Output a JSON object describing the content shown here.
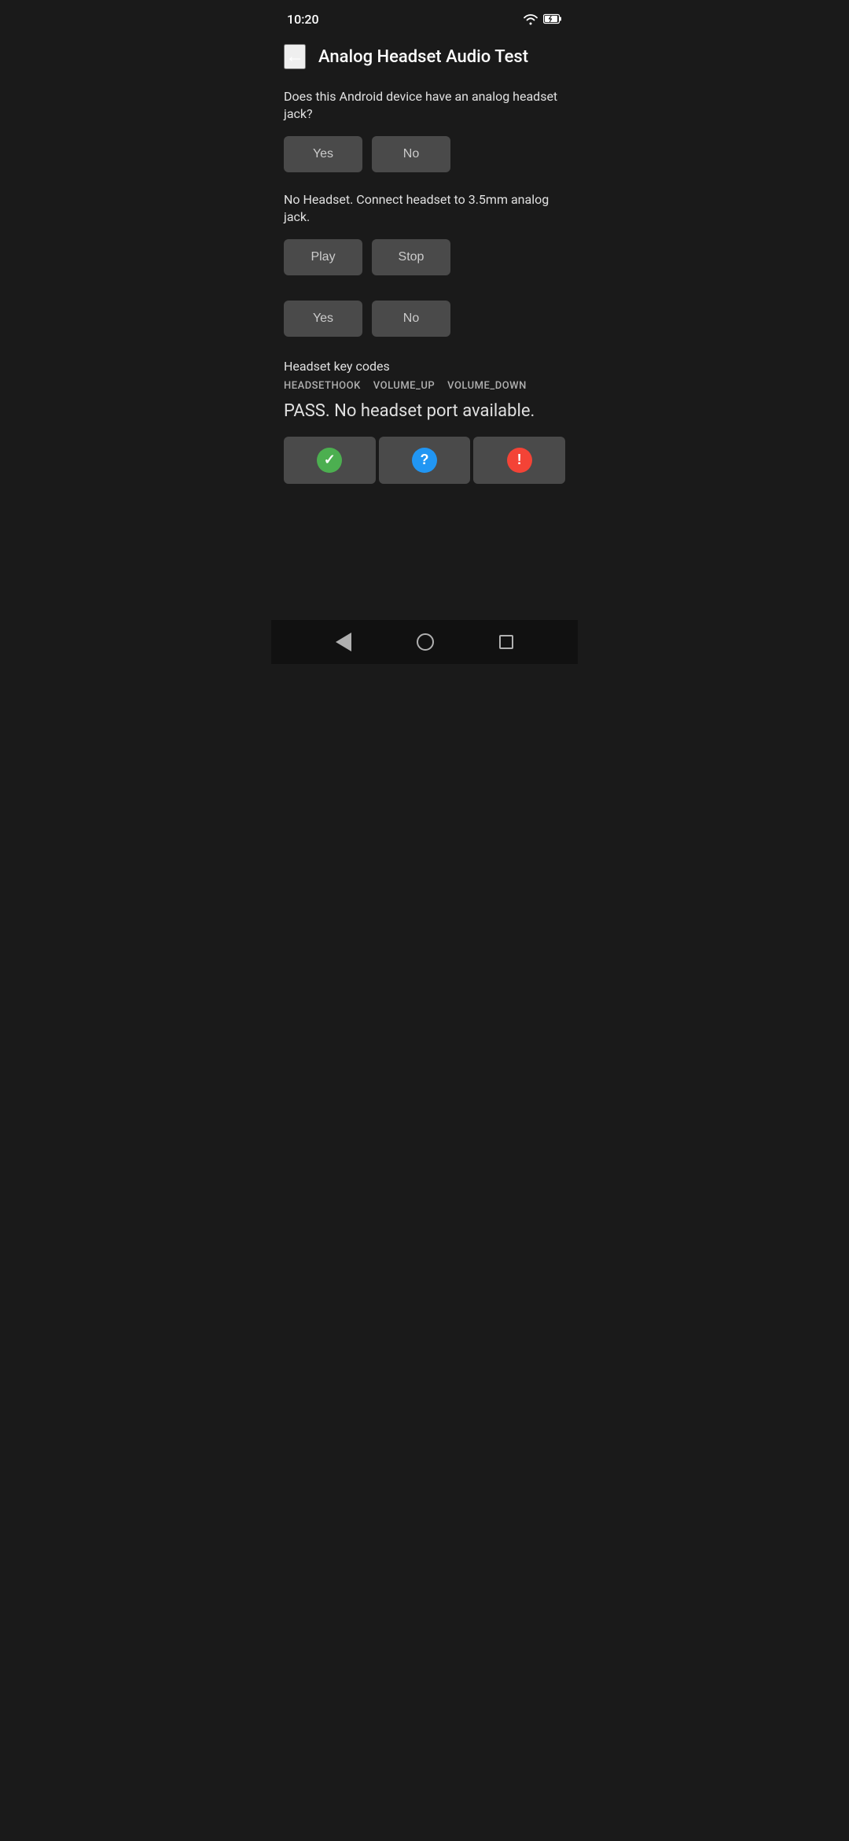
{
  "statusBar": {
    "time": "10:20"
  },
  "header": {
    "title": "Analog Headset Audio Test",
    "backLabel": "←"
  },
  "section1": {
    "question": "Does this Android device have an analog headset jack?",
    "yesLabel": "Yes",
    "noLabel": "No"
  },
  "section2": {
    "instruction": "No Headset. Connect headset to 3.5mm analog jack.",
    "playLabel": "Play",
    "stopLabel": "Stop"
  },
  "section3": {
    "yesLabel": "Yes",
    "noLabel": "No"
  },
  "keyCodes": {
    "sectionLabel": "Headset key codes",
    "codes": [
      "HEADSETHOOK",
      "VOLUME_UP",
      "VOLUME_DOWN"
    ]
  },
  "passText": "PASS. No headset port available.",
  "actionButtons": {
    "passIcon": "✓",
    "helpIcon": "?",
    "failIcon": "!"
  },
  "navBar": {
    "backTitle": "back",
    "homeTitle": "home",
    "recentsTitle": "recents"
  }
}
